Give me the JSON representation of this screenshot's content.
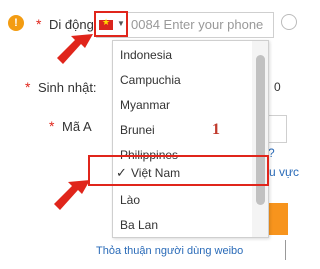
{
  "badge_text": "!",
  "required_mark": "*",
  "fields": {
    "mobile_label": "Di động:",
    "birthday_label": "Sinh nhật:",
    "code_label": "Mã A"
  },
  "phone": {
    "code": "0084",
    "placeholder": "Enter your phone"
  },
  "dropdown": {
    "items": [
      "Indonesia",
      "Campuchia",
      "Myanmar",
      "Brunei",
      "Philippines",
      "Việt Nam",
      "Lào",
      "Ba Lan"
    ],
    "selected": "Việt Nam",
    "check": "✓"
  },
  "annotation_step": "1",
  "partial_texts": {
    "birthday_tail": "0",
    "question_tail": "?",
    "region_tail": "u vực",
    "terms_link": "Thỏa thuận người dùng weibo"
  },
  "colors": {
    "highlight": "#e0251b",
    "badge": "#f39c12",
    "link": "#2a6bb8"
  }
}
